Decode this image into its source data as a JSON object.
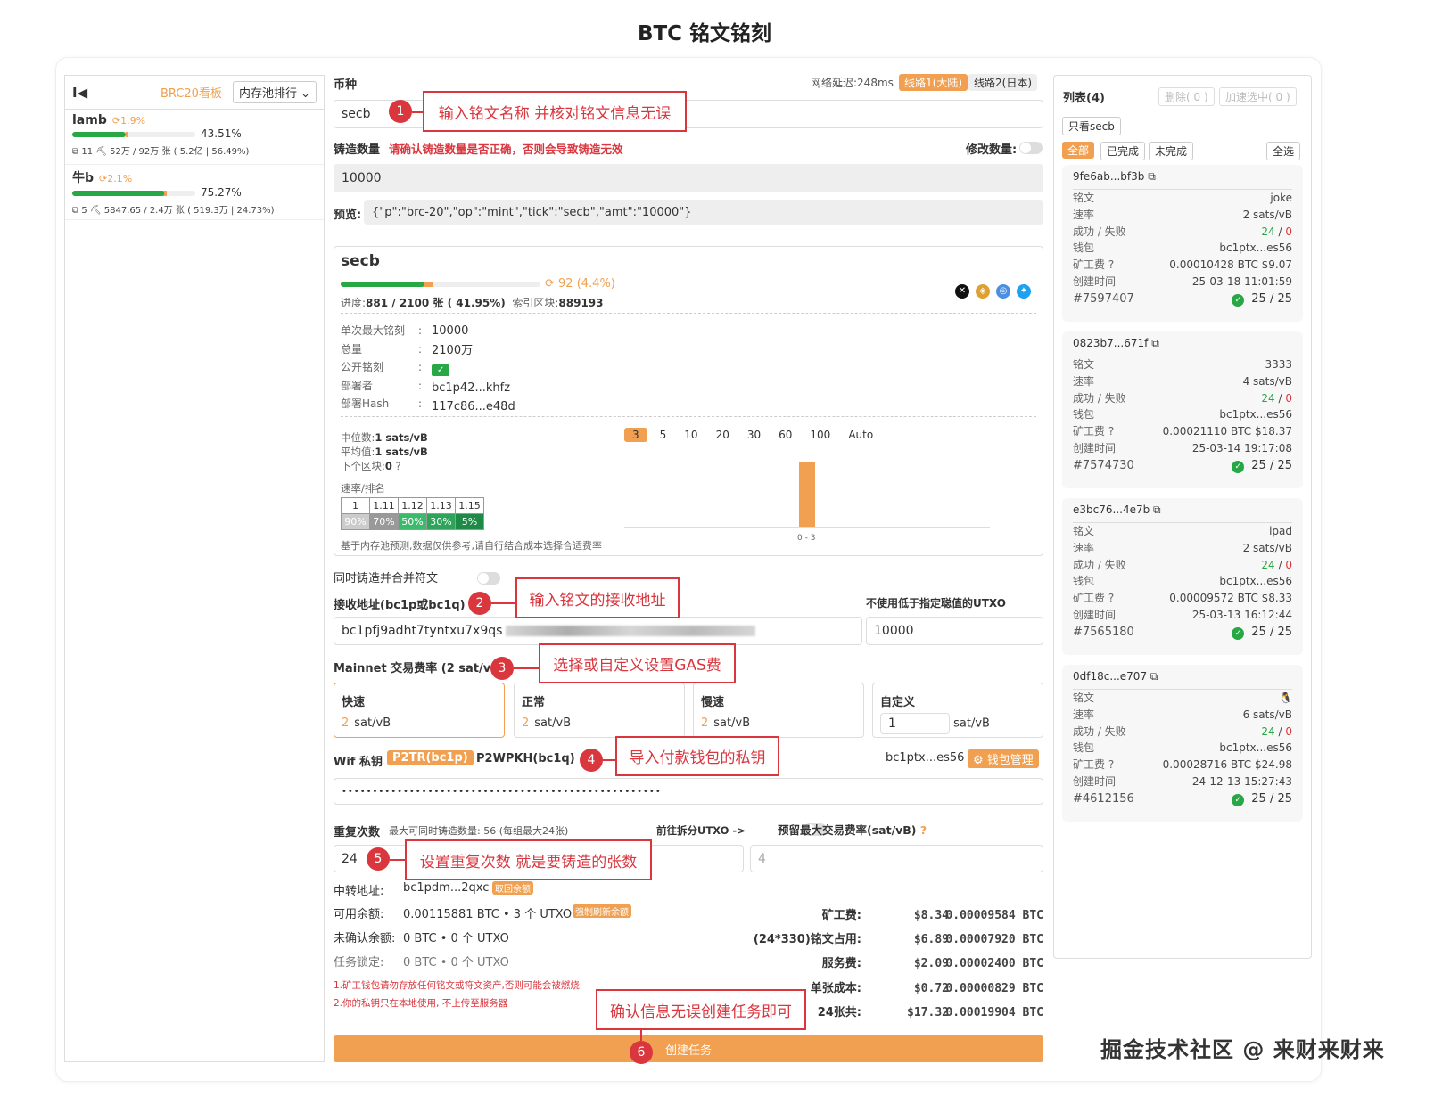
{
  "page_title": "BTC 铭文铭刻",
  "left_panel": {
    "first_button": "I◀",
    "brc20_link": "BRC20看板",
    "sort_select": "内存池排行",
    "coins": [
      {
        "name": "lamb",
        "change": "1.9%",
        "progress": 0.4351,
        "pct": "43.51%",
        "stats": "11 ⛏ 52万 / 92万 张 ( 5.2亿 | 56.49%)"
      },
      {
        "name": "牛b",
        "change": "2.1%",
        "progress": 0.7527,
        "pct": "75.27%",
        "stats": "5 ⛏ 5847.65 / 2.4万 张 ( 519.3万 | 24.73%)"
      }
    ]
  },
  "main": {
    "coin_label": "币种",
    "network_latency": "网络延迟:248ms",
    "route1": "线路1(大陆)",
    "route2": "线路2(日本)",
    "coin_value": "secb",
    "mint_amount_label": "铸造数量",
    "mint_warning": "请确认铸造数量是否正确，否则会导致铸造无效",
    "modify_qty_label": "修改数量:",
    "mint_amount_value": "10000",
    "preview_label": "预览:",
    "preview_value": "{\"p\":\"brc-20\",\"op\":\"mint\",\"tick\":\"secb\",\"amt\":\"10000\"}",
    "card": {
      "name": "secb",
      "progress": 0.4195,
      "holders": "92 (4.4%)",
      "progress_text_label": "进度:",
      "progress_text_value": "881 / 2100 张 ( 41.95%)",
      "index_label": "索引区块:",
      "index_value": "889193",
      "details": [
        {
          "k": "单次最大铭刻",
          "v": "10000"
        },
        {
          "k": "总量",
          "v": "2100万"
        },
        {
          "k": "公开铭刻",
          "v": "✓"
        },
        {
          "k": "部署者",
          "v": "bc1p42...khfz"
        },
        {
          "k": "部署Hash",
          "v": "117c86...e48d"
        }
      ],
      "median_label": "中位数:",
      "median_value": "1 sats/vB",
      "avg_label": "平均值:",
      "avg_value": "1 sats/vB",
      "next_block_label": "下个区块:",
      "next_block_value": "0",
      "rate_rank_label": "速率/排名",
      "rate_row": [
        "1",
        "1.11",
        "1.12",
        "1.13",
        "1.15"
      ],
      "rank_row": [
        "90%",
        "70%",
        "50%",
        "30%",
        "5%"
      ],
      "note": "基于内存池预测,数据仅供参考,请自行结合成本选择合适费率",
      "segments": [
        "3",
        "5",
        "10",
        "20",
        "30",
        "60",
        "100",
        "Auto"
      ],
      "chart_xlabel": "0 - 3"
    },
    "merge_label": "同时铸造并合并符文",
    "recv_label": "接收地址(bc1p或bc1q)",
    "utxo_min_label": "不使用低于指定聪值的UTXO",
    "recv_value": "bc1pfj9adht7tyntxu7x9qs",
    "utxo_min_value": "10000",
    "fee_label": "Mainnet 交易费率 (2 sat/vB)",
    "fees": [
      {
        "name": "快速",
        "value": "2",
        "unit": "sat/vB"
      },
      {
        "name": "正常",
        "value": "2",
        "unit": "sat/vB"
      },
      {
        "name": "慢速",
        "value": "2",
        "unit": "sat/vB"
      }
    ],
    "custom_fee_name": "自定义",
    "custom_fee_value": "1",
    "custom_fee_unit": "sat/vB",
    "wif_label": "Wif 私钥",
    "p2tr": "P2TR(bc1p)",
    "p2wpkh": "P2WPKH(bc1q)",
    "wallet_addr": "bc1ptx...es56",
    "wallet_mgmt": "钱包管理",
    "wif_value": "••••••••••••••••••••••••••••••••••••••••••••••••••••",
    "repeat_label": "重复次数",
    "repeat_hint": "最大可同时铸造数量: 56 (每组最大24张)",
    "split_utxo_label": "前往拆分UTXO ->",
    "reserve_fee_label": "预留最大交易费率(sat/vB)",
    "repeat_value": "24",
    "reserve_fee_placeholder": "4",
    "relay_label": "中转地址:",
    "relay_value": "bc1pdm...2qxc",
    "withdraw_btn": "取回余额",
    "balance_label": "可用余额:",
    "balance_value": "0.00115881 BTC • 3 个 UTXO",
    "refresh_btn": "强制刷新余额",
    "unconfirmed_label": "未确认余额:",
    "unconfirmed_value": "0 BTC • 0 个 UTXO",
    "locked_label": "任务锁定:",
    "locked_value": "0 BTC • 0 个 UTXO",
    "warn1": "1.矿工钱包请勿存放任何铭文或符文资产,否则可能会被燃烧",
    "warn2": "2.你的私钥只在本地使用, 不上传至服务器",
    "summary": [
      {
        "k": "矿工费:",
        "usd": "$8.34",
        "btc": "0.00009584 BTC"
      },
      {
        "k": "(24*330)铭文占用:",
        "usd": "$6.89",
        "btc": "0.00007920 BTC"
      },
      {
        "k": "服务费:",
        "usd": "$2.09",
        "btc": "0.00002400 BTC"
      },
      {
        "k": "单张成本:",
        "usd": "$0.72",
        "btc": "0.00000829 BTC"
      },
      {
        "k": "24张共:",
        "usd": "$17.32",
        "btc": "0.00019904 BTC"
      }
    ],
    "create_btn": "创建任务"
  },
  "annotations": [
    {
      "n": "1",
      "text": "输入铭文名称 并核对铭文信息无误"
    },
    {
      "n": "2",
      "text": "输入铭文的接收地址"
    },
    {
      "n": "3",
      "text": "选择或自定义设置GAS费"
    },
    {
      "n": "4",
      "text": "导入付款钱包的私钥"
    },
    {
      "n": "5",
      "text": "设置重复次数 就是要铸造的张数"
    },
    {
      "n": "6",
      "text": "确认信息无误创建任务即可"
    }
  ],
  "right_panel": {
    "title": "列表(4)",
    "delete_btn": "删除( 0 )",
    "speed_btn": "加速选中( 0 )",
    "only_secb": "只看secb",
    "filters": [
      "全部",
      "已完成",
      "未完成"
    ],
    "select_all": "全选",
    "row_labels": [
      "铭文",
      "速率",
      "成功 / 失败",
      "钱包",
      "矿工费",
      "创建时间"
    ],
    "tasks": [
      {
        "hash": "9fe6ab...bf3b",
        "inscription": "joke",
        "rate": "2 sats/vB",
        "success": "24",
        "fail": "0",
        "wallet": "bc1ptx...es56",
        "fee": "0.00010428 BTC $9.07",
        "time": "25-03-18 11:01:59",
        "id": "#7597407",
        "count": "25 / 25"
      },
      {
        "hash": "0823b7...671f",
        "inscription": "3333",
        "rate": "4 sats/vB",
        "success": "24",
        "fail": "0",
        "wallet": "bc1ptx...es56",
        "fee": "0.00021110 BTC $18.37",
        "time": "25-03-14 19:17:08",
        "id": "#7574730",
        "count": "25 / 25"
      },
      {
        "hash": "e3bc76...4e7b",
        "inscription": "ipad",
        "rate": "2 sats/vB",
        "success": "24",
        "fail": "0",
        "wallet": "bc1ptx...es56",
        "fee": "0.00009572 BTC $8.33",
        "time": "25-03-13 16:12:44",
        "id": "#7565180",
        "count": "25 / 25"
      },
      {
        "hash": "0df18c...e707",
        "inscription": "🐧",
        "rate": "6 sats/vB",
        "success": "24",
        "fail": "0",
        "wallet": "bc1ptx...es56",
        "fee": "0.00028716 BTC $24.98",
        "time": "24-12-13 15:27:43",
        "id": "#4612156",
        "count": "25 / 25"
      }
    ]
  },
  "watermark": "掘金技术社区 @ 来财来财来",
  "colors": {
    "accent": "#f0a050",
    "annotation": "#d9363e",
    "success": "#28a745"
  }
}
